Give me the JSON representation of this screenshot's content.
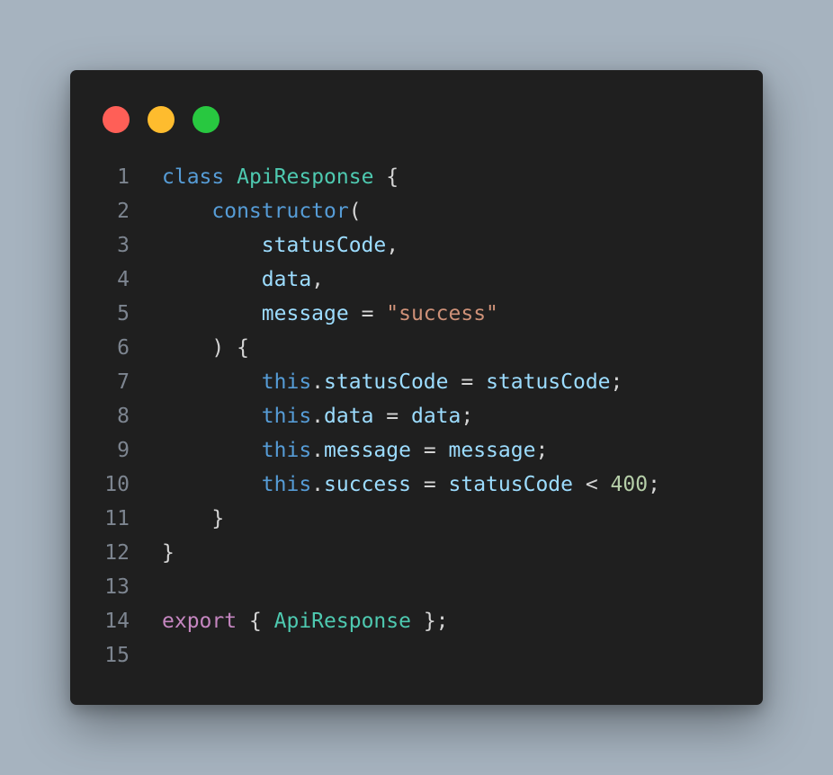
{
  "window": {
    "buttons": {
      "close_color": "#ff5f57",
      "minimize_color": "#febc2e",
      "maximize_color": "#28c840"
    }
  },
  "code_lines": [
    {
      "number": "1",
      "tokens": [
        {
          "text": "class",
          "kind": "kw"
        },
        {
          "text": " ",
          "kind": "pun"
        },
        {
          "text": "ApiResponse",
          "kind": "cls"
        },
        {
          "text": " {",
          "kind": "pun"
        }
      ]
    },
    {
      "number": "2",
      "tokens": [
        {
          "text": "    ",
          "kind": "pun"
        },
        {
          "text": "constructor",
          "kind": "fn"
        },
        {
          "text": "(",
          "kind": "pun"
        }
      ]
    },
    {
      "number": "3",
      "tokens": [
        {
          "text": "        ",
          "kind": "pun"
        },
        {
          "text": "statusCode",
          "kind": "var"
        },
        {
          "text": ",",
          "kind": "pun"
        }
      ]
    },
    {
      "number": "4",
      "tokens": [
        {
          "text": "        ",
          "kind": "pun"
        },
        {
          "text": "data",
          "kind": "var"
        },
        {
          "text": ",",
          "kind": "pun"
        }
      ]
    },
    {
      "number": "5",
      "tokens": [
        {
          "text": "        ",
          "kind": "pun"
        },
        {
          "text": "message",
          "kind": "var"
        },
        {
          "text": " = ",
          "kind": "pun"
        },
        {
          "text": "\"success\"",
          "kind": "str"
        }
      ]
    },
    {
      "number": "6",
      "tokens": [
        {
          "text": "    ) {",
          "kind": "pun"
        }
      ]
    },
    {
      "number": "7",
      "tokens": [
        {
          "text": "        ",
          "kind": "pun"
        },
        {
          "text": "this",
          "kind": "this"
        },
        {
          "text": ".",
          "kind": "pun"
        },
        {
          "text": "statusCode",
          "kind": "var"
        },
        {
          "text": " = ",
          "kind": "pun"
        },
        {
          "text": "statusCode",
          "kind": "var"
        },
        {
          "text": ";",
          "kind": "pun"
        }
      ]
    },
    {
      "number": "8",
      "tokens": [
        {
          "text": "        ",
          "kind": "pun"
        },
        {
          "text": "this",
          "kind": "this"
        },
        {
          "text": ".",
          "kind": "pun"
        },
        {
          "text": "data",
          "kind": "var"
        },
        {
          "text": " = ",
          "kind": "pun"
        },
        {
          "text": "data",
          "kind": "var"
        },
        {
          "text": ";",
          "kind": "pun"
        }
      ]
    },
    {
      "number": "9",
      "tokens": [
        {
          "text": "        ",
          "kind": "pun"
        },
        {
          "text": "this",
          "kind": "this"
        },
        {
          "text": ".",
          "kind": "pun"
        },
        {
          "text": "message",
          "kind": "var"
        },
        {
          "text": " = ",
          "kind": "pun"
        },
        {
          "text": "message",
          "kind": "var"
        },
        {
          "text": ";",
          "kind": "pun"
        }
      ]
    },
    {
      "number": "10",
      "tokens": [
        {
          "text": "        ",
          "kind": "pun"
        },
        {
          "text": "this",
          "kind": "this"
        },
        {
          "text": ".",
          "kind": "pun"
        },
        {
          "text": "success",
          "kind": "var"
        },
        {
          "text": " = ",
          "kind": "pun"
        },
        {
          "text": "statusCode",
          "kind": "var"
        },
        {
          "text": " < ",
          "kind": "pun"
        },
        {
          "text": "400",
          "kind": "num"
        },
        {
          "text": ";",
          "kind": "pun"
        }
      ]
    },
    {
      "number": "11",
      "tokens": [
        {
          "text": "    }",
          "kind": "pun"
        }
      ]
    },
    {
      "number": "12",
      "tokens": [
        {
          "text": "}",
          "kind": "pun"
        }
      ]
    },
    {
      "number": "13",
      "tokens": []
    },
    {
      "number": "14",
      "tokens": [
        {
          "text": "export",
          "kind": "exp"
        },
        {
          "text": " { ",
          "kind": "pun"
        },
        {
          "text": "ApiResponse",
          "kind": "cls"
        },
        {
          "text": " };",
          "kind": "pun"
        }
      ]
    },
    {
      "number": "15",
      "tokens": []
    }
  ]
}
